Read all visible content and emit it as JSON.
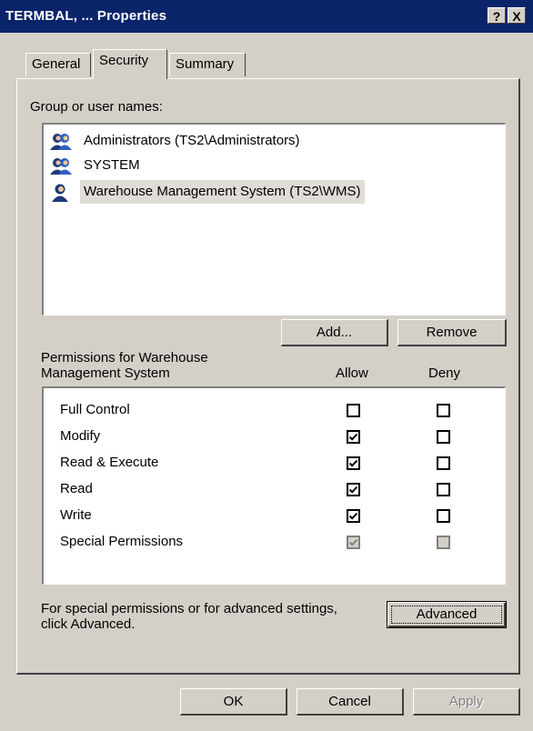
{
  "window": {
    "title": "TERMBAL, ... Properties",
    "help_label": "?",
    "close_label": "X"
  },
  "tabs": [
    {
      "label": "General"
    },
    {
      "label": "Security"
    },
    {
      "label": "Summary"
    }
  ],
  "users": {
    "heading": "Group or user names:",
    "items": [
      {
        "name": "Administrators (TS2\\Administrators)",
        "icon": "group-icon"
      },
      {
        "name": "SYSTEM",
        "icon": "group-icon"
      },
      {
        "name": "Warehouse Management System (TS2\\WMS)",
        "icon": "user-icon",
        "selected": true
      }
    ]
  },
  "buttons": {
    "add": "Add...",
    "remove": "Remove",
    "advanced": "Advanced",
    "ok": "OK",
    "cancel": "Cancel",
    "apply": "Apply"
  },
  "permissions": {
    "heading_line1": "Permissions for Warehouse",
    "heading_line2": "Management System",
    "allow_label": "Allow",
    "deny_label": "Deny",
    "rows": [
      {
        "name": "Full Control",
        "allow": false,
        "deny": false
      },
      {
        "name": "Modify",
        "allow": true,
        "deny": false
      },
      {
        "name": "Read & Execute",
        "allow": true,
        "deny": false
      },
      {
        "name": "Read",
        "allow": true,
        "deny": false
      },
      {
        "name": "Write",
        "allow": true,
        "deny": false
      },
      {
        "name": "Special Permissions",
        "allow": true,
        "deny": false,
        "disabled": true
      }
    ]
  },
  "advanced_note": {
    "line1": "For special permissions or for advanced settings,",
    "line2": "click Advanced."
  }
}
